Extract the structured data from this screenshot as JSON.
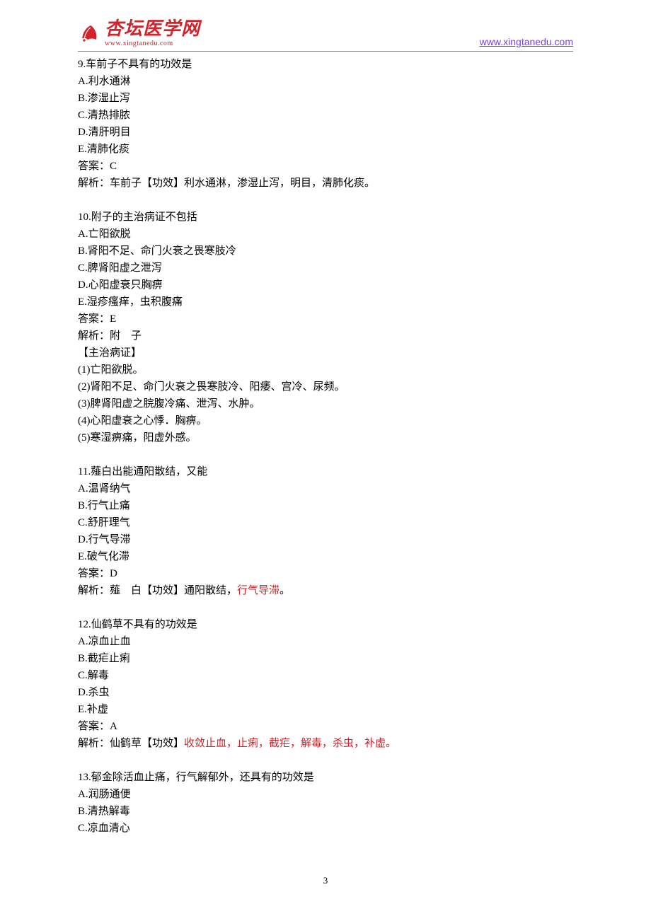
{
  "header": {
    "logo_cn": "杏坛医学网",
    "logo_url": "www.xingtanedu.com",
    "right_link": "www.xingtanedu.com"
  },
  "q9": {
    "stem": "9.车前子不具有的功效是",
    "A": "A.利水通淋",
    "B": "B.渗湿止泻",
    "C": "C.清热排脓",
    "D": "D.清肝明目",
    "E": "E.清肺化痰",
    "answer": "答案：C",
    "explain": "解析：车前子【功效】利水通淋，渗湿止泻，明目，清肺化痰。"
  },
  "q10": {
    "stem": "10.附子的主治病证不包括",
    "A": "A.亡阳欲脱",
    "B": "B.肾阳不足、命门火衰之畏寒肢冷",
    "C": "C.脾肾阳虚之泄泻",
    "D": "D.心阳虚衰只胸痹",
    "E": "E.湿疹瘙痒，虫积腹痛",
    "answer": "答案：E",
    "explain1": "解析：附　子",
    "explain2": "【主治病证】",
    "i1": "(1)亡阳欲脱。",
    "i2": "(2)肾阳不足、命门火衰之畏寒肢冷、阳痿、宫冷、尿频。",
    "i3": "(3)脾肾阳虚之脘腹冷痛、泄泻、水肿。",
    "i4": "(4)心阳虚衰之心悸．胸痹。",
    "i5": "(5)寒湿痹痛，阳虚外感。"
  },
  "q11": {
    "stem": "11.薤白出能通阳散结，又能",
    "A": "A.温肾纳气",
    "B": "B.行气止痛",
    "C": "C.舒肝理气",
    "D": "D.行气导滞",
    "E": "E.破气化滞",
    "answer": "答案：D",
    "explain_a": "解析：薤　白【功效】通阳散结，",
    "explain_b": "行气导滞",
    "explain_c": "。"
  },
  "q12": {
    "stem": "12.仙鹤草不具有的功效是",
    "A": "A.凉血止血",
    "B": "B.截疟止痢",
    "C": "C.解毒",
    "D": "D.杀虫",
    "E": "E.补虚",
    "answer": "答案：A",
    "explain_a": "解析：仙鹤草【功效】",
    "explain_b": "收敛止血，止痢，截疟，解毒，杀虫，补虚。"
  },
  "q13": {
    "stem": "13.郁金除活血止痛，行气解郁外，还具有的功效是",
    "A": "A.润肠通便",
    "B": "B.清热解毒",
    "C": "C.凉血清心"
  },
  "page_number": "3"
}
